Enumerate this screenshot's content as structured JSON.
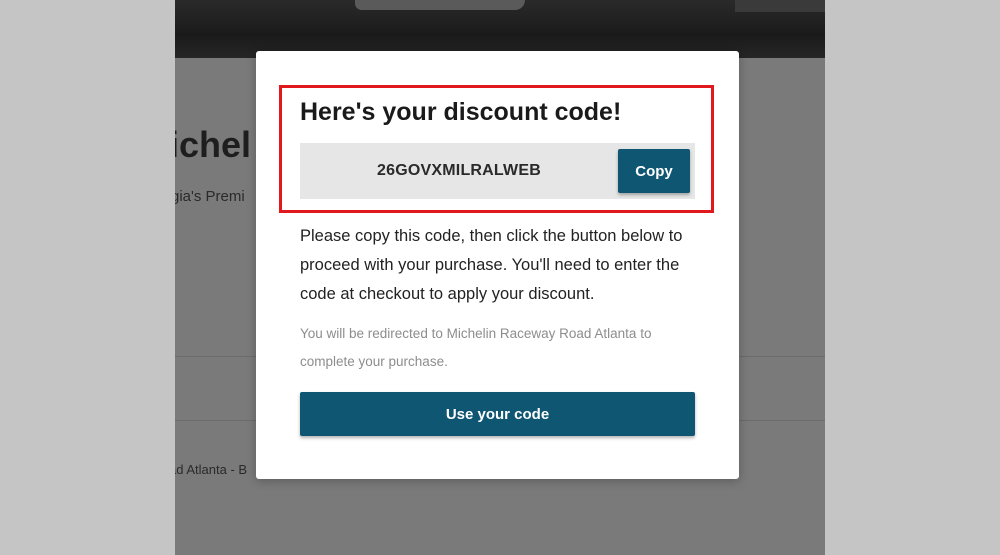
{
  "background_page": {
    "title_fragment": "ichel",
    "subtitle_fragment": "gia's Premi",
    "footer_fragment": "ad Atlanta - B"
  },
  "modal": {
    "title": "Here's your discount code!",
    "discount_code": "26GOVXMILRALWEB",
    "copy_label": "Copy",
    "instructions": "Please copy this code, then click the button below to proceed with your purchase. You'll need to enter the code at checkout to apply your discount.",
    "redirect_note": "You will be redirected to Michelin Raceway Road Atlanta to complete your purchase.",
    "use_code_label": "Use your code"
  },
  "colors": {
    "primary_button": "#0f5672",
    "highlight_border": "#e1191f",
    "overlay": "#c5c5c5",
    "code_box": "#e6e6e6"
  }
}
